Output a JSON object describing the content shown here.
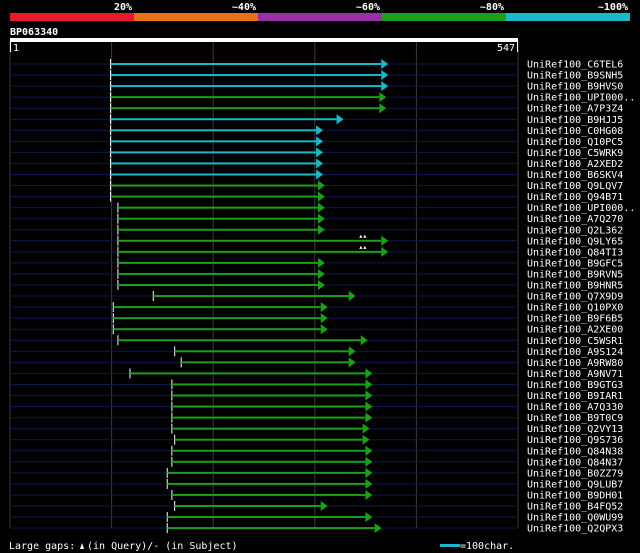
{
  "colors": {
    "background": "#000000",
    "text": "#ffffff",
    "guide_line": "#3a3a3a",
    "row_line": "#0b1a4a",
    "identity_bands": [
      "#e8192c",
      "#e8701a",
      "#9b2fa6",
      "#1aa01a",
      "#1ab8c8"
    ]
  },
  "legend": {
    "percent_labels": [
      "20%",
      "~40%",
      "~60%",
      "~80%",
      "~100%"
    ]
  },
  "query": {
    "name": "BP063340",
    "length": 547,
    "start_label": "1",
    "end_label": "547"
  },
  "hits": [
    {
      "name": "UniRef100_C6TEL6",
      "start": 109,
      "end": 400,
      "color": "#1ab8c8",
      "arrows": 0
    },
    {
      "name": "UniRef100_B9SNH5",
      "start": 109,
      "end": 400,
      "color": "#1ab8c8",
      "arrows": 0
    },
    {
      "name": "UniRef100_B9HVS0",
      "start": 109,
      "end": 400,
      "color": "#1ab8c8",
      "arrows": 0
    },
    {
      "name": "UniRef100_UPI000..",
      "start": 109,
      "end": 398,
      "color": "#1aa01a",
      "arrows": 0
    },
    {
      "name": "UniRef100_A7P3Z4",
      "start": 109,
      "end": 398,
      "color": "#1aa01a",
      "arrows": 0
    },
    {
      "name": "UniRef100_B9HJJ5",
      "start": 109,
      "end": 352,
      "color": "#1ab8c8",
      "arrows": 0
    },
    {
      "name": "UniRef100_C0HG08",
      "start": 109,
      "end": 330,
      "color": "#1ab8c8",
      "arrows": 0
    },
    {
      "name": "UniRef100_Q10PC5",
      "start": 109,
      "end": 330,
      "color": "#1ab8c8",
      "arrows": 0
    },
    {
      "name": "UniRef100_C5WRK9",
      "start": 109,
      "end": 330,
      "color": "#1ab8c8",
      "arrows": 0
    },
    {
      "name": "UniRef100_A2XED2",
      "start": 109,
      "end": 330,
      "color": "#1ab8c8",
      "arrows": 0
    },
    {
      "name": "UniRef100_B6SKV4",
      "start": 109,
      "end": 330,
      "color": "#1ab8c8",
      "arrows": 0
    },
    {
      "name": "UniRef100_Q9LQV7",
      "start": 109,
      "end": 332,
      "color": "#1aa01a",
      "arrows": 0
    },
    {
      "name": "UniRef100_Q94B71",
      "start": 109,
      "end": 332,
      "color": "#1aa01a",
      "arrows": 0
    },
    {
      "name": "UniRef100_UPI000..",
      "start": 117,
      "end": 332,
      "color": "#1aa01a",
      "arrows": 0
    },
    {
      "name": "UniRef100_A7Q270",
      "start": 117,
      "end": 332,
      "color": "#1aa01a",
      "arrows": 0
    },
    {
      "name": "UniRef100_Q2L362",
      "start": 117,
      "end": 332,
      "color": "#1aa01a",
      "arrows": 0
    },
    {
      "name": "UniRef100_Q9LY65",
      "start": 117,
      "end": 400,
      "color": "#1aa01a",
      "arrows": 2
    },
    {
      "name": "UniRef100_Q84TI3",
      "start": 117,
      "end": 400,
      "color": "#1aa01a",
      "arrows": 2
    },
    {
      "name": "UniRef100_B9GFC5",
      "start": 117,
      "end": 332,
      "color": "#1aa01a",
      "arrows": 0
    },
    {
      "name": "UniRef100_B9RVN5",
      "start": 117,
      "end": 332,
      "color": "#1aa01a",
      "arrows": 0
    },
    {
      "name": "UniRef100_B9HNR5",
      "start": 117,
      "end": 332,
      "color": "#1aa01a",
      "arrows": 0
    },
    {
      "name": "UniRef100_Q7X9D9",
      "start": 155,
      "end": 365,
      "color": "#1aa01a",
      "arrows": 0
    },
    {
      "name": "UniRef100_Q10PX0",
      "start": 112,
      "end": 335,
      "color": "#1aa01a",
      "arrows": 0
    },
    {
      "name": "UniRef100_B9F6B5",
      "start": 112,
      "end": 335,
      "color": "#1aa01a",
      "arrows": 0
    },
    {
      "name": "UniRef100_A2XE00",
      "start": 112,
      "end": 335,
      "color": "#1aa01a",
      "arrows": 0
    },
    {
      "name": "UniRef100_C5WSR1",
      "start": 117,
      "end": 378,
      "color": "#1aa01a",
      "arrows": 0
    },
    {
      "name": "UniRef100_A9S124",
      "start": 178,
      "end": 365,
      "color": "#1aa01a",
      "arrows": 0
    },
    {
      "name": "UniRef100_A9RW80",
      "start": 185,
      "end": 365,
      "color": "#1aa01a",
      "arrows": 0
    },
    {
      "name": "UniRef100_A9NV71",
      "start": 130,
      "end": 383,
      "color": "#1aa01a",
      "arrows": 0
    },
    {
      "name": "UniRef100_B9GTG3",
      "start": 175,
      "end": 383,
      "color": "#1aa01a",
      "arrows": 0
    },
    {
      "name": "UniRef100_B9IAR1",
      "start": 175,
      "end": 383,
      "color": "#1aa01a",
      "arrows": 0
    },
    {
      "name": "UniRef100_A7Q330",
      "start": 175,
      "end": 383,
      "color": "#1aa01a",
      "arrows": 0
    },
    {
      "name": "UniRef100_B9T0C9",
      "start": 175,
      "end": 383,
      "color": "#1aa01a",
      "arrows": 0
    },
    {
      "name": "UniRef100_Q2VY13",
      "start": 175,
      "end": 380,
      "color": "#1aa01a",
      "arrows": 0
    },
    {
      "name": "UniRef100_Q9S736",
      "start": 178,
      "end": 380,
      "color": "#1aa01a",
      "arrows": 0
    },
    {
      "name": "UniRef100_Q84N38",
      "start": 175,
      "end": 383,
      "color": "#1aa01a",
      "arrows": 0
    },
    {
      "name": "UniRef100_Q84N37",
      "start": 175,
      "end": 383,
      "color": "#1aa01a",
      "arrows": 0
    },
    {
      "name": "UniRef100_B0ZZ79",
      "start": 170,
      "end": 383,
      "color": "#1aa01a",
      "arrows": 0
    },
    {
      "name": "UniRef100_Q9LUB7",
      "start": 170,
      "end": 383,
      "color": "#1aa01a",
      "arrows": 0
    },
    {
      "name": "UniRef100_B9DH01",
      "start": 175,
      "end": 383,
      "color": "#1aa01a",
      "arrows": 0
    },
    {
      "name": "UniRef100_B4FQ52",
      "start": 178,
      "end": 335,
      "color": "#1aa01a",
      "arrows": 0
    },
    {
      "name": "UniRef100_Q0WU99",
      "start": 170,
      "end": 383,
      "color": "#1aa01a",
      "arrows": 0
    },
    {
      "name": "UniRef100_Q2QPX3",
      "start": 170,
      "end": 393,
      "color": "#1aa01a",
      "arrows": 0
    }
  ],
  "footer": {
    "gaps_label": "Large gaps:",
    "query_gap_text": "(in Query)/- (in Subject)",
    "scale_text": "=100char.",
    "scale_color": "#1ab8c8"
  }
}
